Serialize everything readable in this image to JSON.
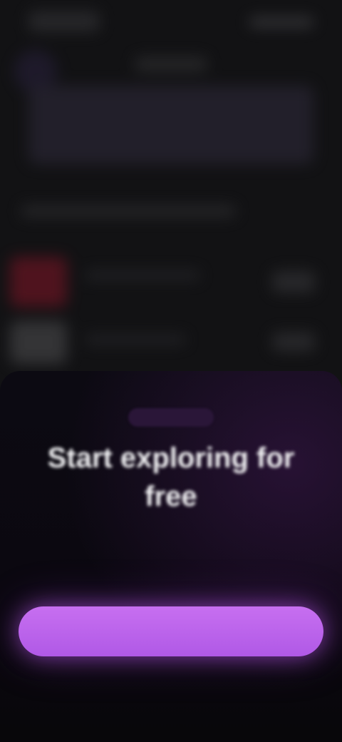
{
  "sheet": {
    "badge": "",
    "title": "Start exploring for free",
    "description": "",
    "small_note": "",
    "cta_label": "",
    "secondary_link": ""
  },
  "colors": {
    "accent": "#b85ee8",
    "sheet_background": "#0b0810",
    "app_background": "#121214"
  }
}
